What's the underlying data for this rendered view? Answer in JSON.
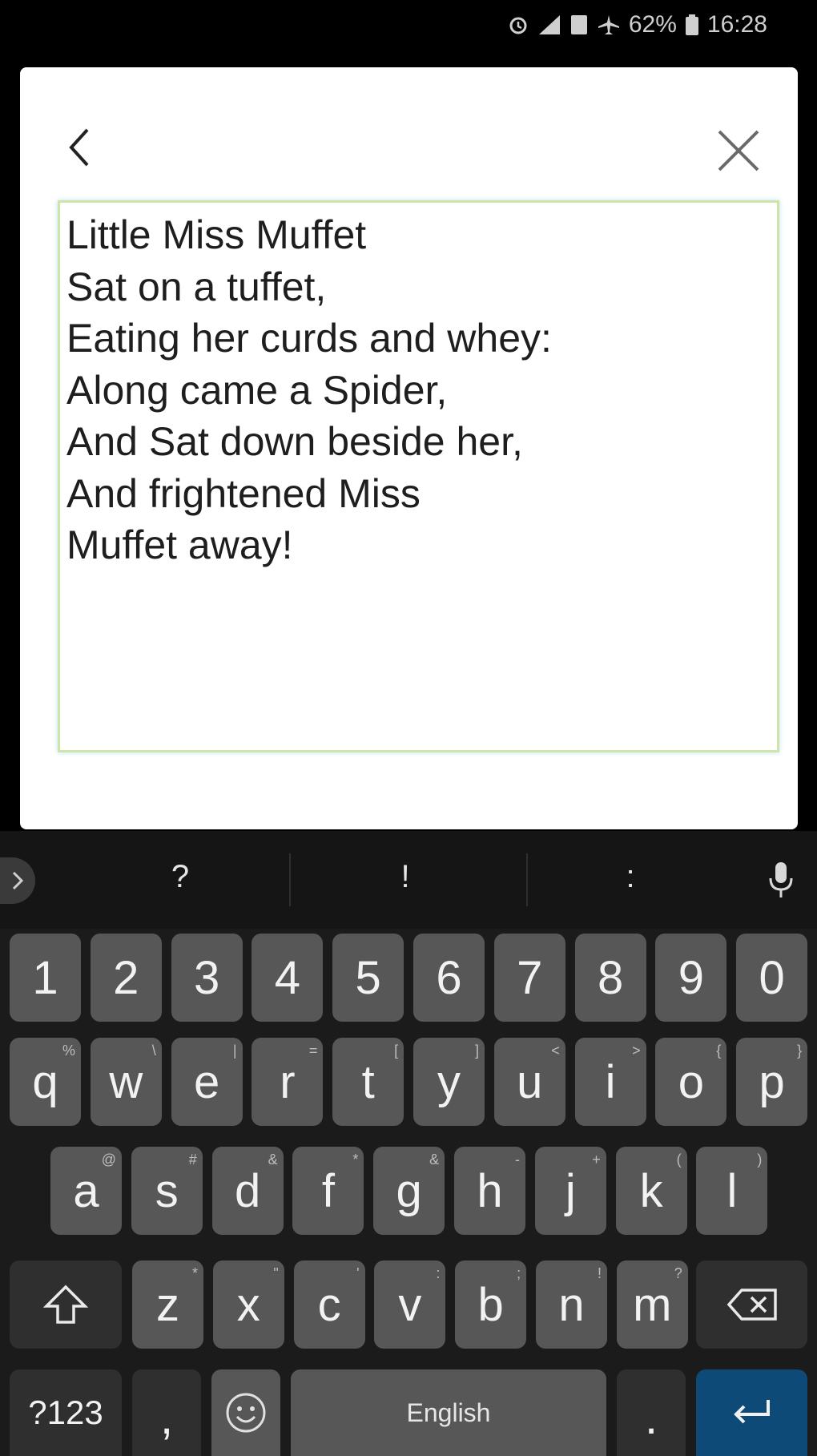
{
  "status_bar": {
    "battery": "62%",
    "time": "16:28",
    "icons": [
      "alarm-icon",
      "signal-icon",
      "sim-icon",
      "airplane-icon",
      "battery-icon"
    ]
  },
  "dialog": {
    "text": "Little Miss Muffet\nSat on a tuffet,\nEating her curds and whey:\nAlong came a Spider,\nAnd Sat down beside her,\nAnd frightened Miss\nMuffet away!",
    "accent_border": "#cfe4a8"
  },
  "keyboard": {
    "suggestions": [
      "?",
      "!",
      ":"
    ],
    "numbers": [
      "1",
      "2",
      "3",
      "4",
      "5",
      "6",
      "7",
      "8",
      "9",
      "0"
    ],
    "row1": [
      "q",
      "w",
      "e",
      "r",
      "t",
      "y",
      "u",
      "i",
      "o",
      "p"
    ],
    "row1_hints": [
      "%",
      "\\",
      "|",
      "=",
      "[",
      "]",
      "<",
      ">",
      "{",
      "}"
    ],
    "row2": [
      "a",
      "s",
      "d",
      "f",
      "g",
      "h",
      "j",
      "k",
      "l"
    ],
    "row2_hints": [
      "@",
      "#",
      "&",
      "*",
      "&",
      "-",
      "+",
      "(",
      ")"
    ],
    "row3": [
      "z",
      "x",
      "c",
      "v",
      "b",
      "n",
      "m"
    ],
    "row3_hints": [
      "*",
      "\"",
      "'",
      ":",
      ";",
      "!",
      "?"
    ],
    "symbols_label": "?123",
    "comma_label": ",",
    "space_label": "English",
    "period_label": ".",
    "enter_color": "#0d4a78",
    "key_color": "#575757"
  }
}
